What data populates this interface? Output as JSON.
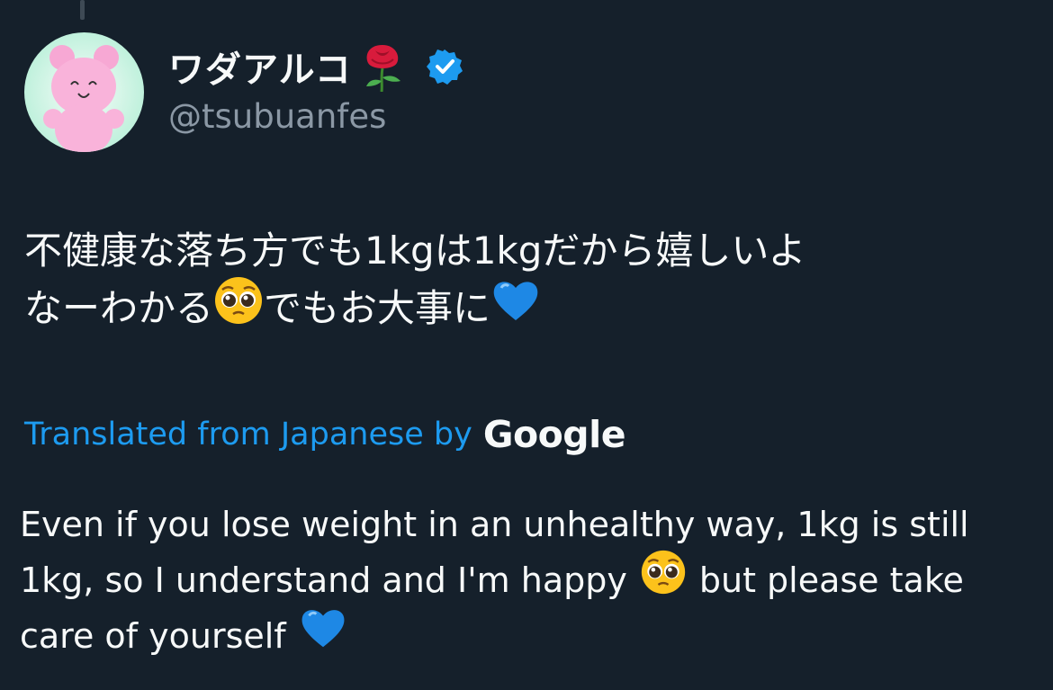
{
  "author": {
    "display_name": "ワダアルコ",
    "handle": "@tsubuanfes",
    "name_emoji": "rose-icon",
    "verified_icon": "verified-badge-icon",
    "verified_color": "#1d9bf0"
  },
  "tweet": {
    "line1": "不健康な落ち方でも1kgは1kgだから嬉しいよ",
    "line2_a": "なーわかる",
    "line2_b": "でもお大事に"
  },
  "translation": {
    "label": "Translated from Japanese by",
    "provider": "Google",
    "line1": "Even if you lose weight in an unhealthy way, 1kg is still",
    "line2_a": "1kg, so I understand and I'm happy",
    "line2_b": "but please take",
    "line3_a": "care of yourself"
  },
  "colors": {
    "background": "#15202b",
    "text": "#f7f9f9",
    "secondary": "#8b98a5",
    "accent": "#1d9bf0"
  }
}
